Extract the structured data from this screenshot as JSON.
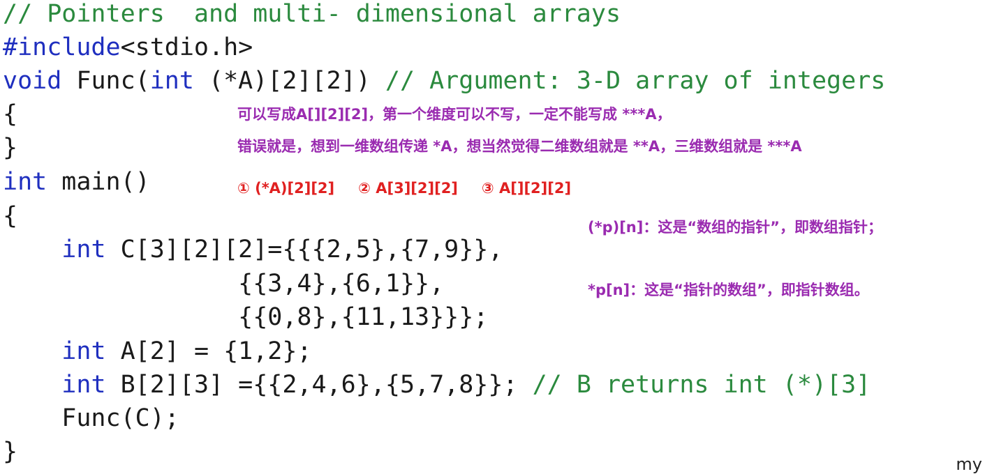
{
  "code": {
    "line1": {
      "comment": "// Pointers  and multi- dimensional arrays"
    },
    "line2": {
      "include": "#include",
      "header": "<stdio.h>"
    },
    "line3": {
      "kw_void": "void",
      "func": " Func(",
      "kw_int": "int",
      "params": " (*A)[2][2])",
      "comment": " // Argument: 3-D array of integers"
    },
    "line4": {
      "text": "{"
    },
    "line5": {
      "text": "}"
    },
    "line6": {
      "kw_int": "int",
      "text": " main()"
    },
    "line7": {
      "text": "{"
    },
    "line8": {
      "indent": "    ",
      "kw_int": "int",
      "text": " C[3][2][2]={{{2,5},{7,9}},"
    },
    "line9": {
      "text": "                {{3,4},{6,1}},"
    },
    "line10": {
      "text": "                {{0,8},{11,13}}};"
    },
    "line11": {
      "indent": "    ",
      "kw_int": "int",
      "text": " A[2] = {1,2};"
    },
    "line12": {
      "indent": "    ",
      "kw_int": "int",
      "text": " B[2][3] ={{2,4,6},{5,7,8}};",
      "comment": " // B returns int (*)[3]"
    },
    "line13": {
      "text": "    Func(C);"
    },
    "line14": {
      "text": "}"
    }
  },
  "annotations": {
    "note1": "可以写成A[][2][2]，第一个维度可以不写，一定不能写成 ***A，",
    "note2": "错误就是，想到一维数组传递 *A，想当然觉得二维数组就是 **A，三维数组就是 ***A",
    "options": [
      "① (*A)[2][2]",
      "② A[3][2][2]",
      "③ A[][2][2]"
    ],
    "array_pointer": "(*p)[n]：这是“数组的指针”，即数组指针；",
    "pointer_array": "*p[n]：这是“指针的数组”，即指针数组。"
  },
  "corner_text": "my",
  "colors": {
    "keyword": "#1f2fbf",
    "comment": "#2b8a3e",
    "purple_note": "#9a2bb0",
    "red_note": "#e02020"
  }
}
